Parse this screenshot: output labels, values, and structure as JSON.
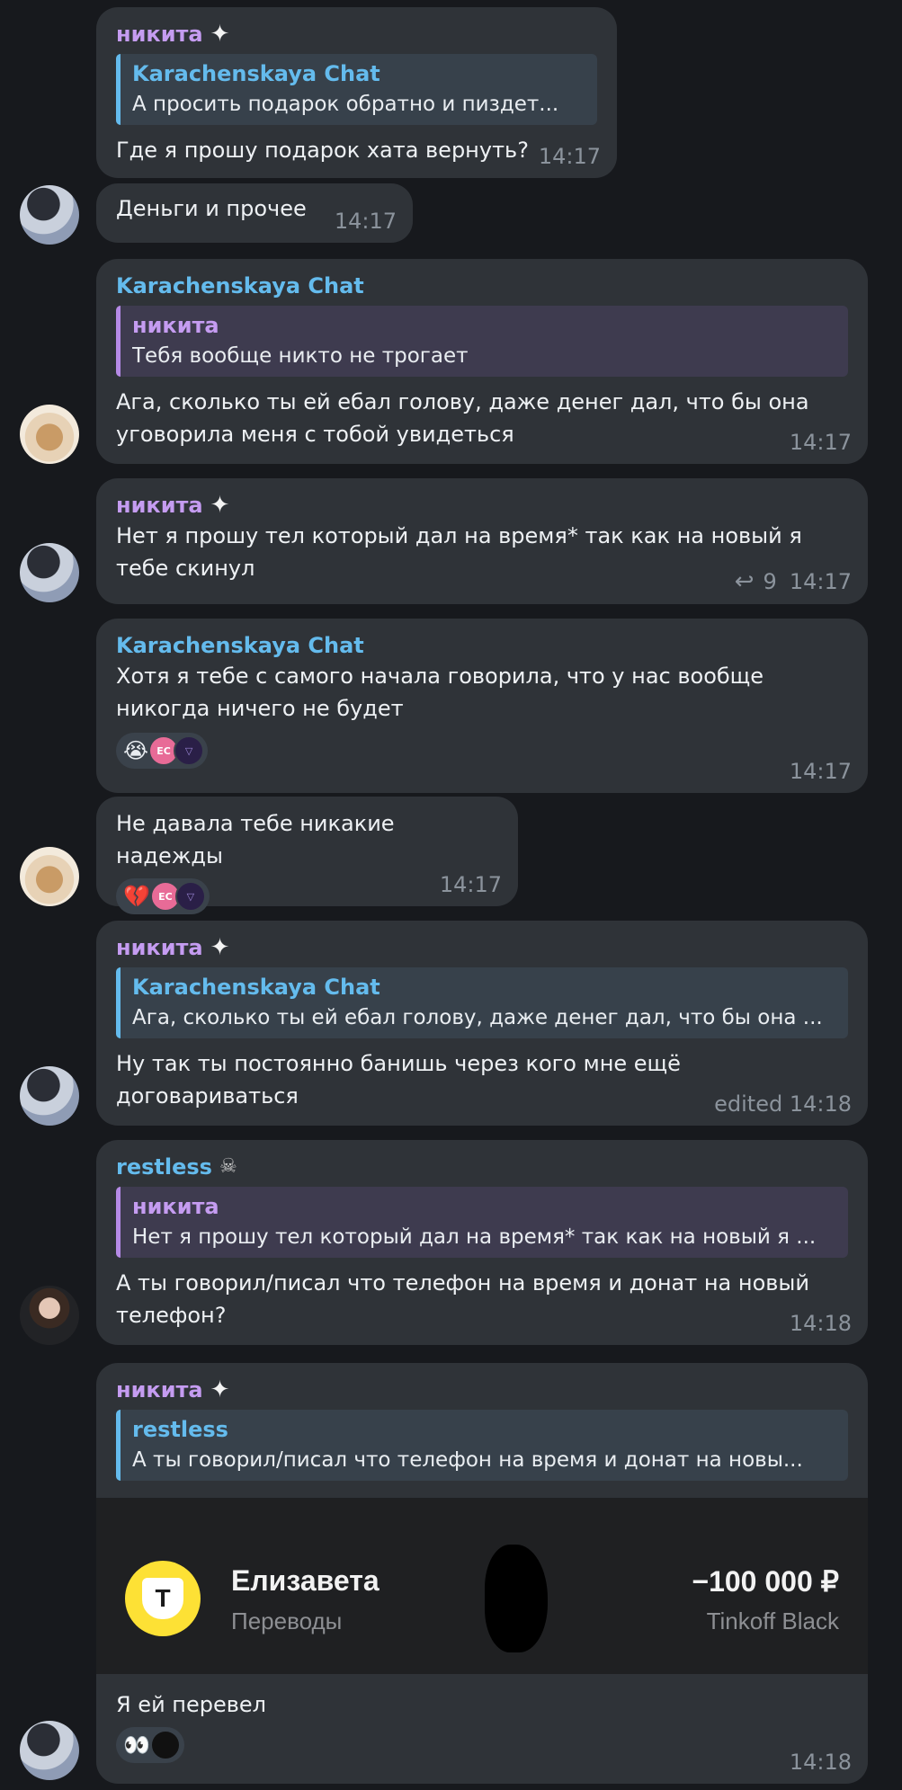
{
  "messages": {
    "m1": {
      "sender": "никита",
      "reply": {
        "name": "Karachenskaya Chat",
        "text": "А просить подарок обратно и пиздет..."
      },
      "text": "Где я прошу подарок хата вернуть?",
      "time": "14:17"
    },
    "m2": {
      "text": "Деньги  и прочее",
      "time": "14:17"
    },
    "m3": {
      "sender": "Karachenskaya Chat",
      "reply": {
        "name": "никита",
        "text": "Тебя вообще никто не трогает"
      },
      "text_line1": "Ага, сколько ты ей ебал голову, даже денег дал, что бы она",
      "text_line2": "уговорила меня с тобой увидеться",
      "time": "14:17"
    },
    "m4": {
      "sender": "никита",
      "text_line1": "Нет я прошу тел который дал на время* так как на новый я",
      "text_line2": "тебе скинул",
      "replies_count": "9",
      "time": "14:17"
    },
    "m5": {
      "sender": "Karachenskaya Chat",
      "text_line1": "Хотя я тебе с самого начала говорила, что у нас вообще",
      "text_line2": "никогда ничего не будет",
      "reaction_emoji": "😭",
      "reaction_avatar": "EC",
      "time": "14:17"
    },
    "m6": {
      "text": "Не давала тебе никакие надежды",
      "reaction_emoji": "💔",
      "reaction_avatar": "EC",
      "time": "14:17"
    },
    "m7": {
      "sender": "никита",
      "reply": {
        "name": "Karachenskaya Chat",
        "text": "Ага, сколько ты ей ебал голову, даже денег дал, что бы она ..."
      },
      "text_line1": "Ну так ты постоянно банишь через кого мне ещё",
      "text_line2": "договариваться",
      "time": "edited 14:18"
    },
    "m8": {
      "sender": "restless",
      "reply": {
        "name": "никита",
        "text": "Нет я прошу тел который дал на время* так как на новый я ..."
      },
      "text_line1": "А ты говорил/писал что телефон на время и донат на новый",
      "text_line2": "телефон?",
      "time": "14:18"
    },
    "m9": {
      "sender": "никита",
      "reply": {
        "name": "restless",
        "text": "А ты говорил/писал что телефон на время и донат на новы..."
      },
      "transfer": {
        "logo_letter": "T",
        "name": "Елизавета",
        "category": "Переводы",
        "amount": "−100 000 ₽",
        "bank": "Tinkoff Black"
      },
      "text": "Я ей перевел",
      "reaction_emoji": "👀",
      "time": "14:18"
    }
  },
  "colors": {
    "background": "#17191d",
    "bubble": "#2f3338",
    "name_purple": "#c59cf1",
    "name_blue": "#64bbed",
    "timestamp": "#8b939c",
    "tinkoff_yellow": "#fde135"
  }
}
